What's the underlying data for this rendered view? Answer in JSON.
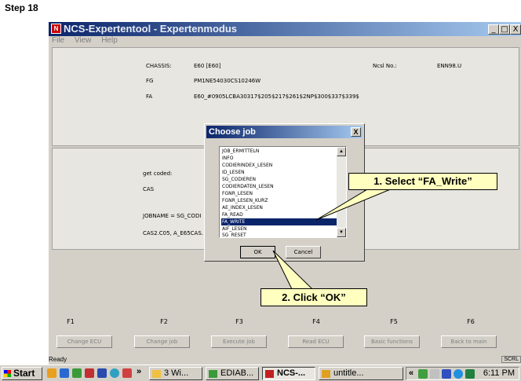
{
  "step_label": "Step 18",
  "window": {
    "title": "NCS-Expertentool - Expertenmodus",
    "buttons": [
      "_",
      "□",
      "X"
    ]
  },
  "menu": [
    "File",
    "View",
    "Help"
  ],
  "info": {
    "chassis_label": "CHASSIS:",
    "chassis_value": "E60 [E60]",
    "fg_label": "FG",
    "fg_value": "PM1NE54030CS10246W",
    "fa_label": "FA",
    "fa_value": "E60_#0905LCBA30317$205$217$261$2NP$300$337$339$",
    "ncsl_label": "Ncsl No.:",
    "ncsl_value": "ENN98.U"
  },
  "middle": {
    "get_coded": "get coded:",
    "cas": "CAS",
    "jobname": "JOBNAME = SG_CODI",
    "cas_line": "CAS2.C05, A_E65CAS."
  },
  "fkeys": [
    {
      "key": "F1",
      "label": "Change ECU"
    },
    {
      "key": "F2",
      "label": "Change job"
    },
    {
      "key": "F3",
      "label": "Execute job"
    },
    {
      "key": "F4",
      "label": "Read ECU"
    },
    {
      "key": "F5",
      "label": "Basic functions"
    },
    {
      "key": "F6",
      "label": "Back to main"
    }
  ],
  "status": {
    "text": "Ready",
    "scrl": "SCRL"
  },
  "dialog": {
    "title": "Choose job",
    "close": "X",
    "items": [
      "JOB_ERMITTELN",
      "INFO",
      "CODIERINDEX_LESEN",
      "ID_LESEN",
      "SG_CODIEREN",
      "CODIERDATEN_LESEN",
      "FGNR_LESEN",
      "FGNR_LESEN_KURZ",
      "AE_INDEX_LESEN",
      "FA_READ",
      "FA_WRITE",
      "AIF_LESEN",
      "SG_RESET"
    ],
    "selected_index": 10,
    "ok": "OK",
    "cancel": "Cancel"
  },
  "callouts": {
    "select": "1. Select “FA_Write”",
    "click": "2. Click “OK”"
  },
  "taskbar": {
    "start": "Start",
    "chevron": "»",
    "items": [
      "3 Wi...",
      "EDIAB...",
      "NCS-...",
      "untitle..."
    ],
    "tray_chevron": "«",
    "clock": "6:11 PM"
  }
}
